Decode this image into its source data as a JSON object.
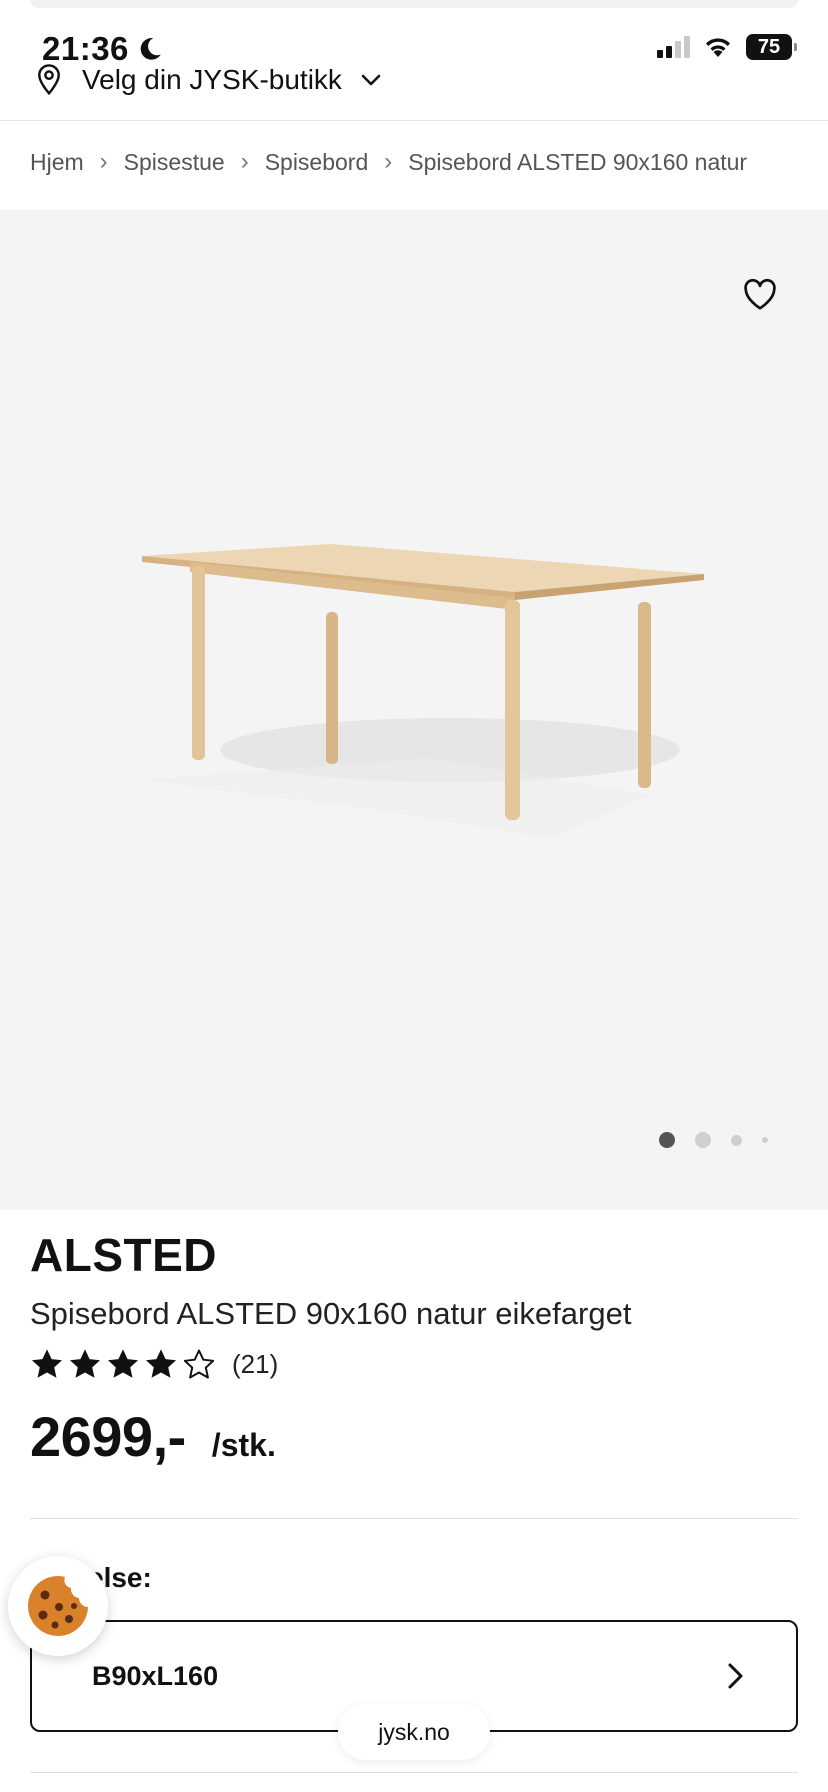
{
  "status_bar": {
    "time": "21:36",
    "battery": "75"
  },
  "store": {
    "label": "Velg din JYSK-butikk"
  },
  "breadcrumb": {
    "items": [
      "Hjem",
      "Spisestue",
      "Spisebord",
      "Spisebord ALSTED 90x160 natur"
    ],
    "separator": "›"
  },
  "gallery": {
    "image_count": 4,
    "active_index": 0
  },
  "product": {
    "brand": "ALSTED",
    "name": "Spisebord ALSTED 90x160 natur eikefarget",
    "rating": 4,
    "rating_max": 5,
    "rating_count": "(21)",
    "price": "2699,-",
    "unit": "/stk."
  },
  "size": {
    "label": "Størrelse:",
    "visible_label": "else:",
    "value": "B90xL160"
  },
  "browser": {
    "url": "jysk.no"
  },
  "colors": {
    "gallery_bg": "#f4f4f4",
    "text": "#111111",
    "table_wood": "#e6c9a0"
  }
}
